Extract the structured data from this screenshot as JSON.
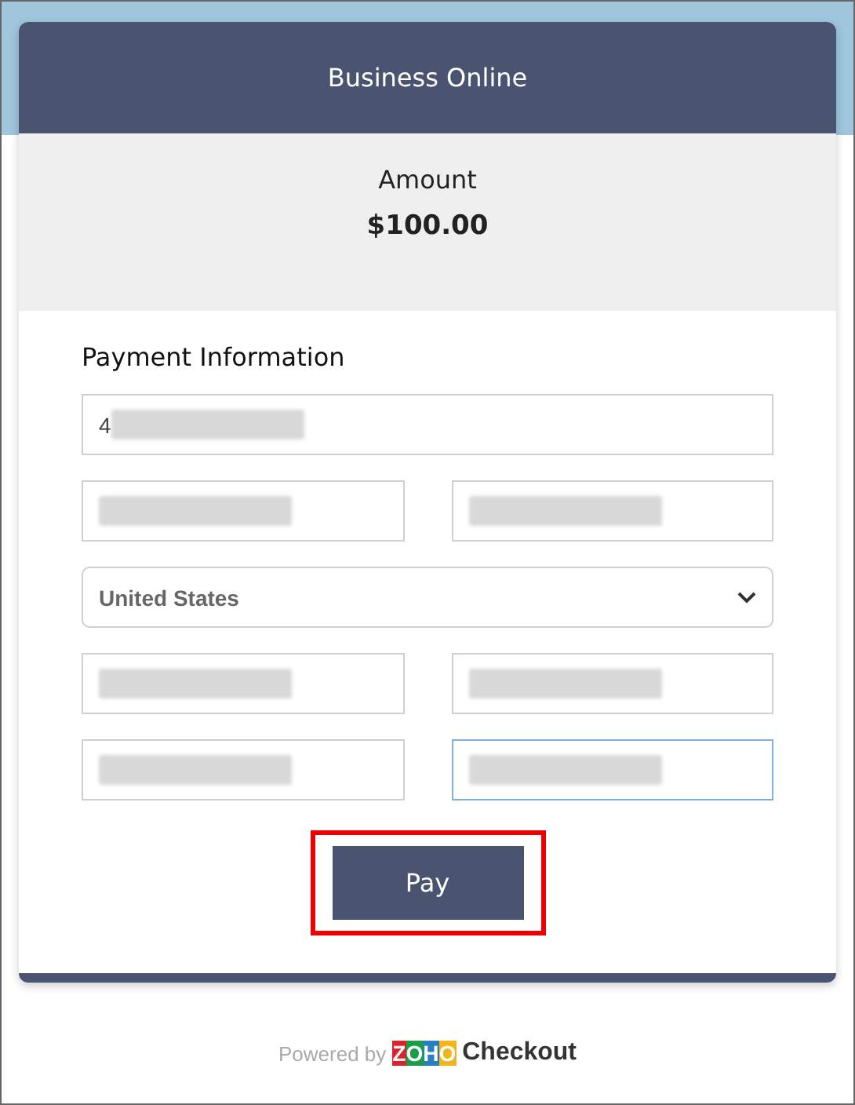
{
  "header": {
    "title": "Business Online"
  },
  "amount": {
    "label": "Amount",
    "value": "$100.00"
  },
  "form": {
    "heading": "Payment Information",
    "rows": [
      [
        {
          "kind": "text",
          "value": "4",
          "redacted": true,
          "focused": false
        }
      ],
      [
        {
          "kind": "text",
          "redacted": true,
          "focused": false
        },
        {
          "kind": "text",
          "redacted": true,
          "focused": false
        }
      ],
      [
        {
          "kind": "select",
          "value": "United States",
          "focused": false
        }
      ],
      [
        {
          "kind": "text",
          "redacted": true,
          "focused": false
        },
        {
          "kind": "text",
          "redacted": true,
          "focused": false
        }
      ],
      [
        {
          "kind": "text",
          "redacted": true,
          "focused": false
        },
        {
          "kind": "text",
          "redacted": true,
          "focused": true
        }
      ]
    ],
    "button": {
      "label": "Pay",
      "highlighted": true
    }
  },
  "footer": {
    "powered_by": "Powered by",
    "logo": "ZOHO",
    "product": "Checkout"
  }
}
